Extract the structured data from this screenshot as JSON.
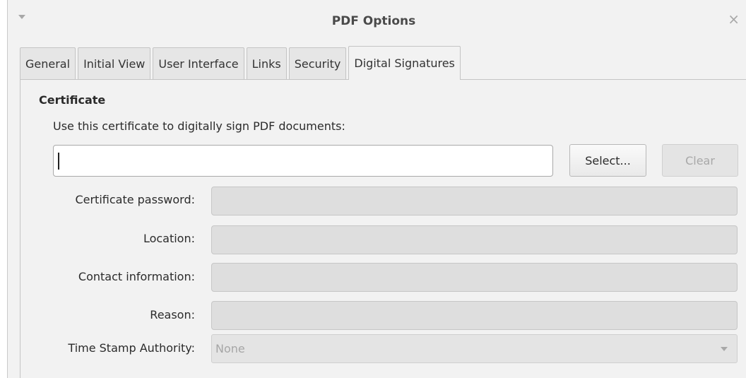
{
  "window": {
    "title": "PDF Options",
    "menu_icon": "chevron-down-icon",
    "close_icon": "close-icon",
    "close_glyph": "×"
  },
  "tabs": [
    {
      "label": "General",
      "active": false
    },
    {
      "label": "Initial View",
      "active": false
    },
    {
      "label": "User Interface",
      "active": false
    },
    {
      "label": "Links",
      "active": false
    },
    {
      "label": "Security",
      "active": false
    },
    {
      "label": "Digital Signatures",
      "active": true
    }
  ],
  "certificate": {
    "section_title": "Certificate",
    "use_label": "Use this certificate to digitally sign PDF documents:",
    "value": "",
    "select_label": "Select...",
    "clear_label": "Clear",
    "clear_enabled": false
  },
  "fields": {
    "password_label": "Certificate password:",
    "location_label": "Location:",
    "contact_label": "Contact information:",
    "reason_label": "Reason:",
    "tsa_label": "Time Stamp Authority:",
    "tsa_value": "None"
  },
  "colors": {
    "window_bg": "#f2f2f2",
    "disabled_field_bg": "#dedede",
    "disabled_text": "#a8a8a8"
  }
}
